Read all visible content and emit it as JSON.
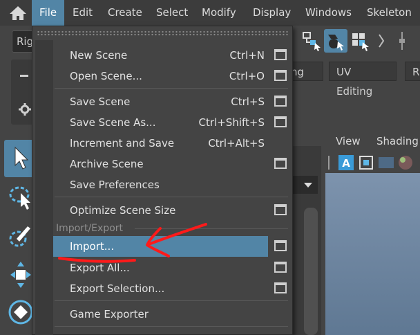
{
  "menubar": {
    "home_icon": "home-icon",
    "items": [
      {
        "label": "File",
        "active": true
      },
      {
        "label": "Edit"
      },
      {
        "label": "Create"
      },
      {
        "label": "Select"
      },
      {
        "label": "Modify"
      },
      {
        "label": "Display"
      },
      {
        "label": "Windows"
      },
      {
        "label": "Skeleton"
      }
    ]
  },
  "toolbar": {
    "mode_combo": "Rig",
    "icons": [
      "select-by-hierarchy-icon",
      "select-by-object-icon",
      "select-by-component-icon",
      "separator-icon"
    ]
  },
  "shelf": {
    "tabs": [
      "ting",
      "UV Editing",
      "R"
    ]
  },
  "toolbox": {
    "tools": [
      "select-tool-icon",
      "lasso-tool-icon",
      "paint-select-tool-icon",
      "move-tool-icon",
      "rotate-tool-icon"
    ]
  },
  "viewport": {
    "menus": [
      "View",
      "Shading"
    ],
    "icons": [
      "camera-attributes-icon",
      "frame-selection-icon",
      "grid-icon",
      "shading-sphere-icon"
    ]
  },
  "file_menu": {
    "items": [
      {
        "label": "New Scene",
        "shortcut": "Ctrl+N",
        "option_box": true
      },
      {
        "label": "Open Scene...",
        "shortcut": "Ctrl+O",
        "option_box": true
      },
      {
        "label": "Save Scene",
        "shortcut": "Ctrl+S",
        "option_box": true
      },
      {
        "label": "Save Scene As...",
        "shortcut": "Ctrl+Shift+S",
        "option_box": true
      },
      {
        "label": "Increment and Save",
        "shortcut": "Ctrl+Alt+S",
        "option_box": false
      },
      {
        "label": "Archive Scene",
        "shortcut": "",
        "option_box": true
      },
      {
        "label": "Save Preferences",
        "shortcut": "",
        "option_box": false
      },
      {
        "label": "Optimize Scene Size",
        "shortcut": "",
        "option_box": true
      },
      {
        "label": "Import...",
        "shortcut": "",
        "option_box": true,
        "highlighted": true
      },
      {
        "label": "Export All...",
        "shortcut": "",
        "option_box": true
      },
      {
        "label": "Export Selection...",
        "shortcut": "",
        "option_box": true
      },
      {
        "label": "Game Exporter",
        "shortcut": "",
        "option_box": false
      }
    ],
    "section_import_export": "Import/Export"
  },
  "annotation": {
    "color": "#ff1a1a"
  },
  "colors": {
    "accent": "#5285a6",
    "menu_bg": "#444444",
    "bar_bg": "#3c3c3c"
  }
}
